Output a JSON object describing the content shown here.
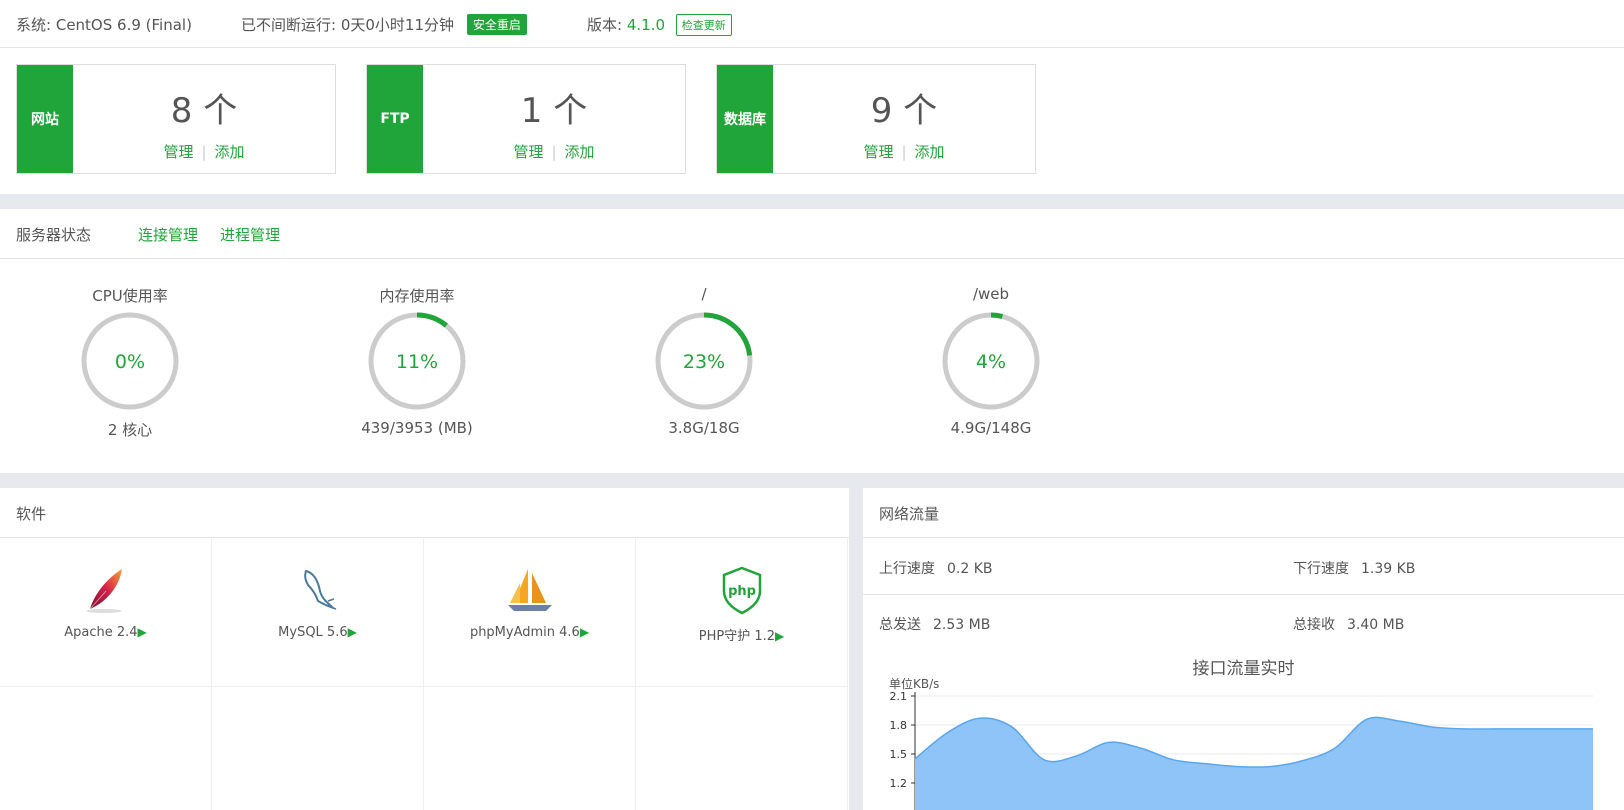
{
  "topbar": {
    "system_label": "系统:",
    "system_value": "CentOS 6.9 (Final)",
    "uptime_label": "已不间断运行:",
    "uptime_value": "0天0小时11分钟",
    "restart_button": "安全重启",
    "version_label": "版本:",
    "version_value": "4.1.0",
    "update_button": "检查更新"
  },
  "stats": [
    {
      "name": "网站",
      "count": "8 个",
      "manage": "管理",
      "add": "添加"
    },
    {
      "name": "FTP",
      "count": "1 个",
      "manage": "管理",
      "add": "添加"
    },
    {
      "name": "数据库",
      "count": "9 个",
      "manage": "管理",
      "add": "添加"
    }
  ],
  "server": {
    "title": "服务器状态",
    "links": [
      "连接管理",
      "进程管理"
    ],
    "gauges": [
      {
        "label": "CPU使用率",
        "value": "0%",
        "percent": 0,
        "sub": "2 核心"
      },
      {
        "label": "内存使用率",
        "value": "11%",
        "percent": 11,
        "sub": "439/3953 (MB)"
      },
      {
        "label": "/",
        "value": "23%",
        "percent": 23,
        "sub": "3.8G/18G"
      },
      {
        "label": "/web",
        "value": "4%",
        "percent": 4,
        "sub": "4.9G/148G"
      }
    ]
  },
  "software": {
    "title": "软件",
    "items": [
      {
        "name": "Apache 2.4",
        "icon": "apache-feather-icon"
      },
      {
        "name": "MySQL 5.6",
        "icon": "mysql-dolphin-icon"
      },
      {
        "name": "phpMyAdmin 4.6",
        "icon": "phpmyadmin-sailboat-icon"
      },
      {
        "name": "PHP守护 1.2",
        "icon": "php-shield-icon"
      }
    ],
    "arrow": "▶"
  },
  "network": {
    "title": "网络流量",
    "up_label": "上行速度",
    "up_value": "0.2 KB",
    "down_label": "下行速度",
    "down_value": "1.39 KB",
    "sent_label": "总发送",
    "sent_value": "2.53 MB",
    "recv_label": "总接收",
    "recv_value": "3.40 MB"
  },
  "colors": {
    "accent": "#20a53a",
    "gauge_track": "#cccccc",
    "chart_fill": "#8ec4f7",
    "chart_line": "#5aa6ec"
  },
  "chart_data": {
    "type": "area",
    "title": "接口流量实时",
    "ylabel": "单位KB/s",
    "yticks": [
      1.2,
      1.5,
      1.8,
      2.1
    ],
    "x": [
      0,
      1,
      2,
      3,
      4,
      5,
      6,
      7,
      8,
      9,
      10,
      11,
      12,
      13,
      14,
      15,
      16,
      17,
      18,
      19,
      20,
      21
    ],
    "values": [
      1.45,
      1.72,
      1.87,
      1.78,
      1.44,
      1.48,
      1.62,
      1.56,
      1.44,
      1.4,
      1.37,
      1.37,
      1.43,
      1.56,
      1.86,
      1.84,
      1.78,
      1.76,
      1.76,
      1.76,
      1.76,
      1.76
    ],
    "ylim": [
      1.2,
      2.1
    ],
    "grid": true
  }
}
